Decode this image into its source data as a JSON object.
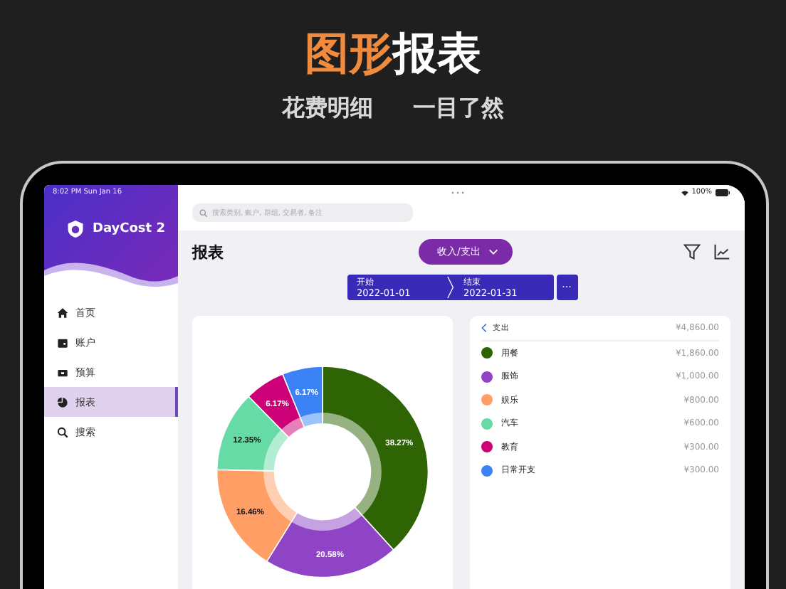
{
  "promo": {
    "title_highlight": "图形",
    "title_rest": "报表",
    "subtitle_left": "花费明细",
    "subtitle_right": "一目了然"
  },
  "status_bar": {
    "time": "8:02 PM  Sun Jan 16",
    "battery": "100%"
  },
  "sidebar": {
    "app_name": "DayCost 2",
    "items": [
      {
        "label": "首页",
        "selected": false
      },
      {
        "label": "账户",
        "selected": false
      },
      {
        "label": "预算",
        "selected": false
      },
      {
        "label": "报表",
        "selected": true
      },
      {
        "label": "搜索",
        "selected": false
      }
    ]
  },
  "search": {
    "placeholder": "搜索类别, 账户, 群组, 交易者, 备注"
  },
  "header": {
    "title": "报表",
    "type_button": "收入/支出"
  },
  "date_range": {
    "start_label": "开始",
    "start": "2022-01-01",
    "end_label": "结束",
    "end": "2022-01-31",
    "more": "···"
  },
  "chart": {
    "chart_data": {
      "type": "donut",
      "categories": [
        "用餐",
        "服饰",
        "娱乐",
        "汽车",
        "教育",
        "日常开支"
      ],
      "series": [
        {
          "name": "支出",
          "values": [
            38.27,
            20.58,
            16.46,
            12.35,
            6.17,
            6.17
          ]
        }
      ],
      "value_labels": [
        "38.27%",
        "20.58%",
        "16.46%",
        "12.35%",
        "6.17%",
        "6.17%"
      ]
    }
  },
  "list": {
    "total": "¥4,860.00",
    "items": [
      {
        "amount": "¥1,860.00",
        "color": "#2f6405"
      },
      {
        "amount": "¥1,000.00",
        "color": "#8e44c4"
      },
      {
        "amount": "¥800.00",
        "color": "#ff9f66"
      },
      {
        "amount": "¥600.00",
        "color": "#66dba6"
      },
      {
        "amount": "¥300.00",
        "color": "#cc0077"
      },
      {
        "amount": "¥300.00",
        "color": "#3b82f6"
      }
    ]
  }
}
